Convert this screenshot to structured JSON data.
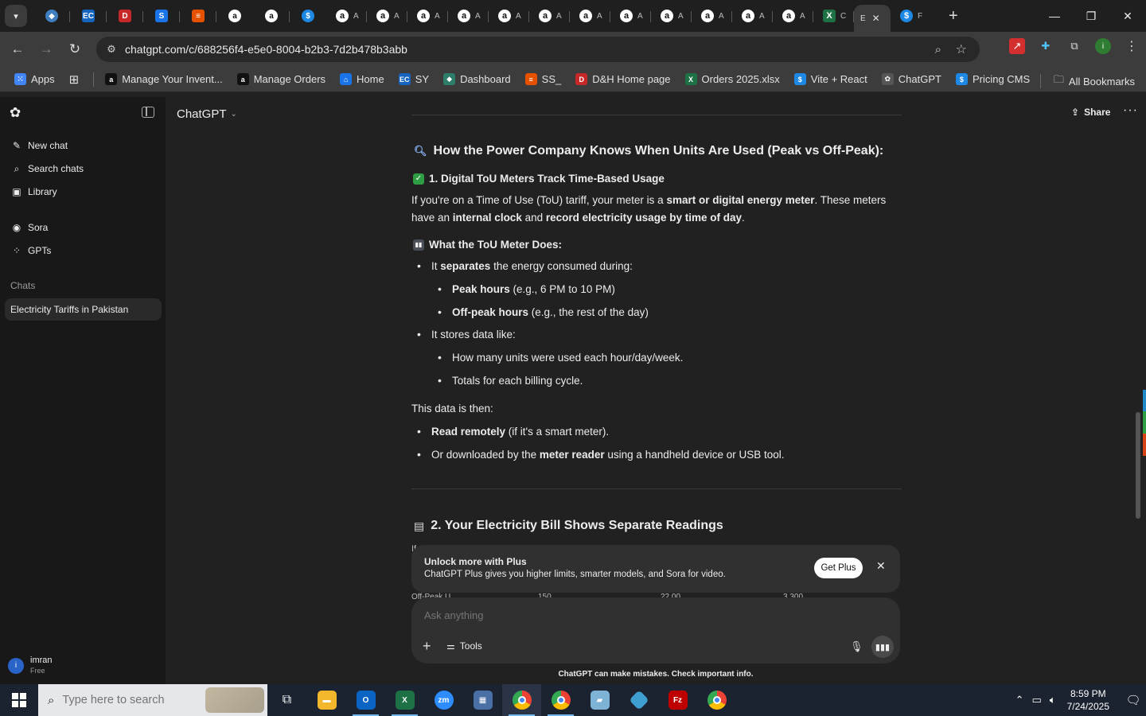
{
  "browser": {
    "active_tab_title": "E",
    "tabs": [
      {
        "title": "A"
      },
      {
        "title": "A"
      },
      {
        "title": "A"
      },
      {
        "title": "A"
      },
      {
        "title": "A"
      },
      {
        "title": "A"
      },
      {
        "title": "A"
      },
      {
        "title": "A"
      },
      {
        "title": "A"
      },
      {
        "title": "A"
      },
      {
        "title": "A"
      },
      {
        "title": "A"
      },
      {
        "title": "C"
      }
    ],
    "last_tab_title": "F",
    "url": "chatgpt.com/c/688256f4-e5e0-8004-b2b3-7d2b478b3abb",
    "bookmarks": [
      {
        "label": "Apps",
        "icon": "apps-grid-icon",
        "color": "#4285f4"
      },
      {
        "label": "Manage Your Invent...",
        "icon": "amazon-icon",
        "color": "#111111"
      },
      {
        "label": "Manage Orders",
        "icon": "amazon-icon",
        "color": "#111111"
      },
      {
        "label": "Home",
        "icon": "home-icon",
        "color": "#1a73e8"
      },
      {
        "label": "SY",
        "icon": "ec-icon",
        "color": "#1565c0"
      },
      {
        "label": "Dashboard",
        "icon": "dashboard-icon",
        "color": "#2e7d6b"
      },
      {
        "label": "SS_",
        "icon": "ss-icon",
        "color": "#e65100"
      },
      {
        "label": "D&H Home page",
        "icon": "dh-icon",
        "color": "#c62828"
      },
      {
        "label": "Orders 2025.xlsx",
        "icon": "excel-icon",
        "color": "#1e7145"
      },
      {
        "label": "Vite + React",
        "icon": "dollar-icon",
        "color": "#1e88e5"
      },
      {
        "label": "ChatGPT",
        "icon": "chatgpt-icon",
        "color": "#555555"
      },
      {
        "label": "Pricing CMS",
        "icon": "dollar-icon",
        "color": "#1e88e5"
      }
    ],
    "all_bookmarks_label": "All Bookmarks"
  },
  "sidebar": {
    "nav": [
      {
        "label": "New chat",
        "icon": "new-chat-icon"
      },
      {
        "label": "Search chats",
        "icon": "search-icon"
      },
      {
        "label": "Library",
        "icon": "library-icon"
      }
    ],
    "nav2": [
      {
        "label": "Sora",
        "icon": "sora-icon"
      },
      {
        "label": "GPTs",
        "icon": "gpts-icon"
      }
    ],
    "chats_heading": "Chats",
    "chats": [
      {
        "title": "Electricity Tariffs in Pakistan"
      }
    ],
    "user": {
      "initial": "i",
      "name": "imran",
      "plan": "Free"
    }
  },
  "header": {
    "model": "ChatGPT",
    "share_label": "Share",
    "more_label": "···"
  },
  "message": {
    "section_title": "How the Power Company Knows When Units Are Used (Peak vs Off-Peak):",
    "sub1_title": "1. Digital ToU Meters Track Time-Based Usage",
    "para1": {
      "a": "If you're on a Time of Use (ToU) tariff, your meter is a ",
      "b": "smart or digital energy meter",
      "c": ". These meters have an ",
      "d": "internal clock",
      "e": " and ",
      "f": "record electricity usage by time of day",
      "g": "."
    },
    "sub2_title": "What the ToU Meter Does:",
    "bullets": {
      "b1_a": "It ",
      "b1_b": "separates",
      "b1_c": " the energy consumed during:",
      "b1_1_bold": "Peak hours",
      "b1_1_rest": " (e.g., 6 PM to 10 PM)",
      "b1_2_bold": "Off-peak hours",
      "b1_2_rest": " (e.g., the rest of the day)",
      "b2": "It stores data like:",
      "b2_1": "How many units were used each hour/day/week.",
      "b2_2": "Totals for each billing cycle."
    },
    "para2": "This data is then:",
    "bullets2": {
      "c1_bold": "Read remotely",
      "c1_rest": " (if it's a smart meter).",
      "c2_a": "Or downloaded by the ",
      "c2_bold": "meter reader",
      "c2_rest": " using a handheld device or USB tool."
    },
    "sec2_title": "2. Your Electricity Bill Shows Separate Readings",
    "peek_top": "If",
    "peek_bottom": [
      "Off-Peak U",
      "150",
      "22.00",
      "3,300"
    ]
  },
  "upsell": {
    "title": "Unlock more with Plus",
    "body": "ChatGPT Plus gives you higher limits, smarter models, and Sora for video.",
    "button": "Get Plus"
  },
  "composer": {
    "placeholder": "Ask anything",
    "tools_label": "Tools"
  },
  "disclaimer": "ChatGPT can make mistakes. Check important info.",
  "taskbar": {
    "search_placeholder": "Type here to search",
    "time": "8:59 PM",
    "date": "7/24/2025"
  }
}
